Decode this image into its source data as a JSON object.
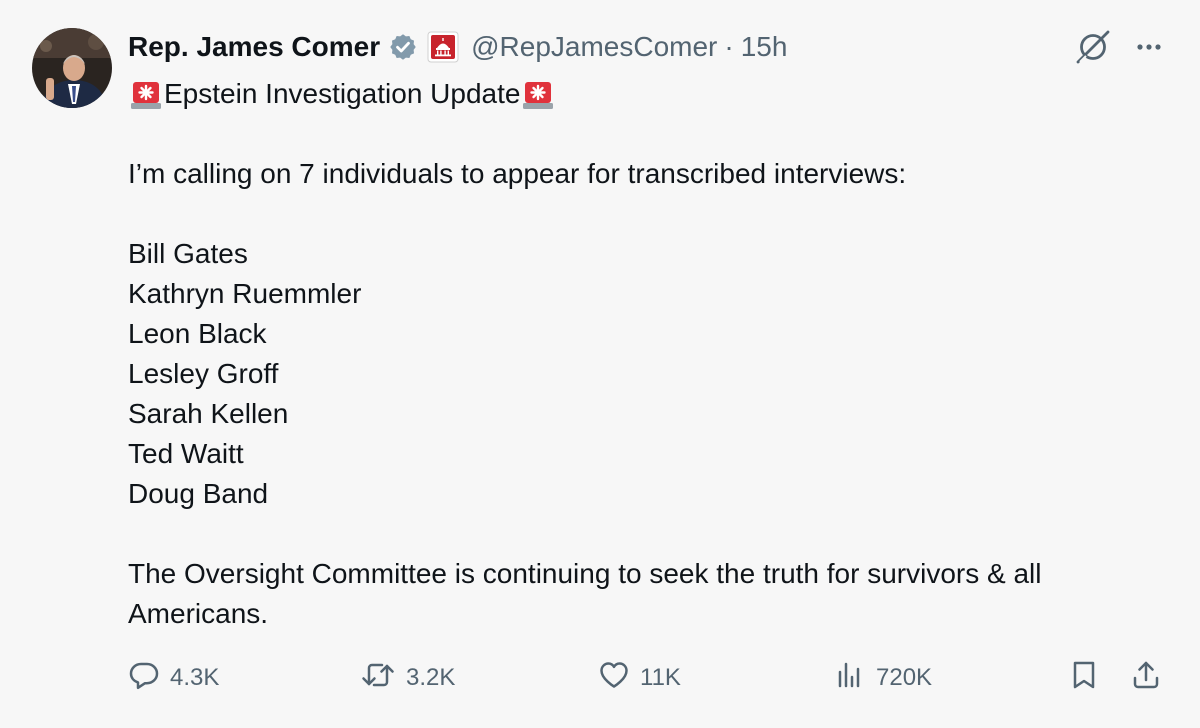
{
  "author": {
    "display_name": "Rep. James Comer",
    "handle": "@RepJamesComer",
    "separator": "·",
    "time": "15h"
  },
  "icons": {
    "verified": "verified-badge-icon",
    "affiliation": "capitol-dome-affiliation-icon",
    "grok": "grok-icon",
    "more": "more-options-icon",
    "siren": "siren-emoji",
    "reply": "reply-icon",
    "repost": "repost-icon",
    "like": "heart-icon",
    "views": "analytics-icon",
    "bookmark": "bookmark-icon",
    "share": "share-icon"
  },
  "colors": {
    "text": "#0f1419",
    "secondary": "#536471",
    "background": "#f7f7f7",
    "verified": "#829aab",
    "affiliation": "#c8232c",
    "siren": "#e0323c"
  },
  "post": {
    "headline": "Epstein Investigation Update",
    "intro": "I’m calling on 7 individuals to appear for transcribed interviews:",
    "names": [
      "Bill Gates",
      "Kathryn Ruemmler",
      "Leon Black",
      "Lesley Groff",
      "Sarah Kellen",
      "Ted Waitt",
      "Doug Band"
    ],
    "closing": "The Oversight Committee is continuing to seek the truth for survivors & all Americans."
  },
  "metrics": {
    "replies": "4.3K",
    "reposts": "3.2K",
    "likes": "11K",
    "views": "720K"
  }
}
